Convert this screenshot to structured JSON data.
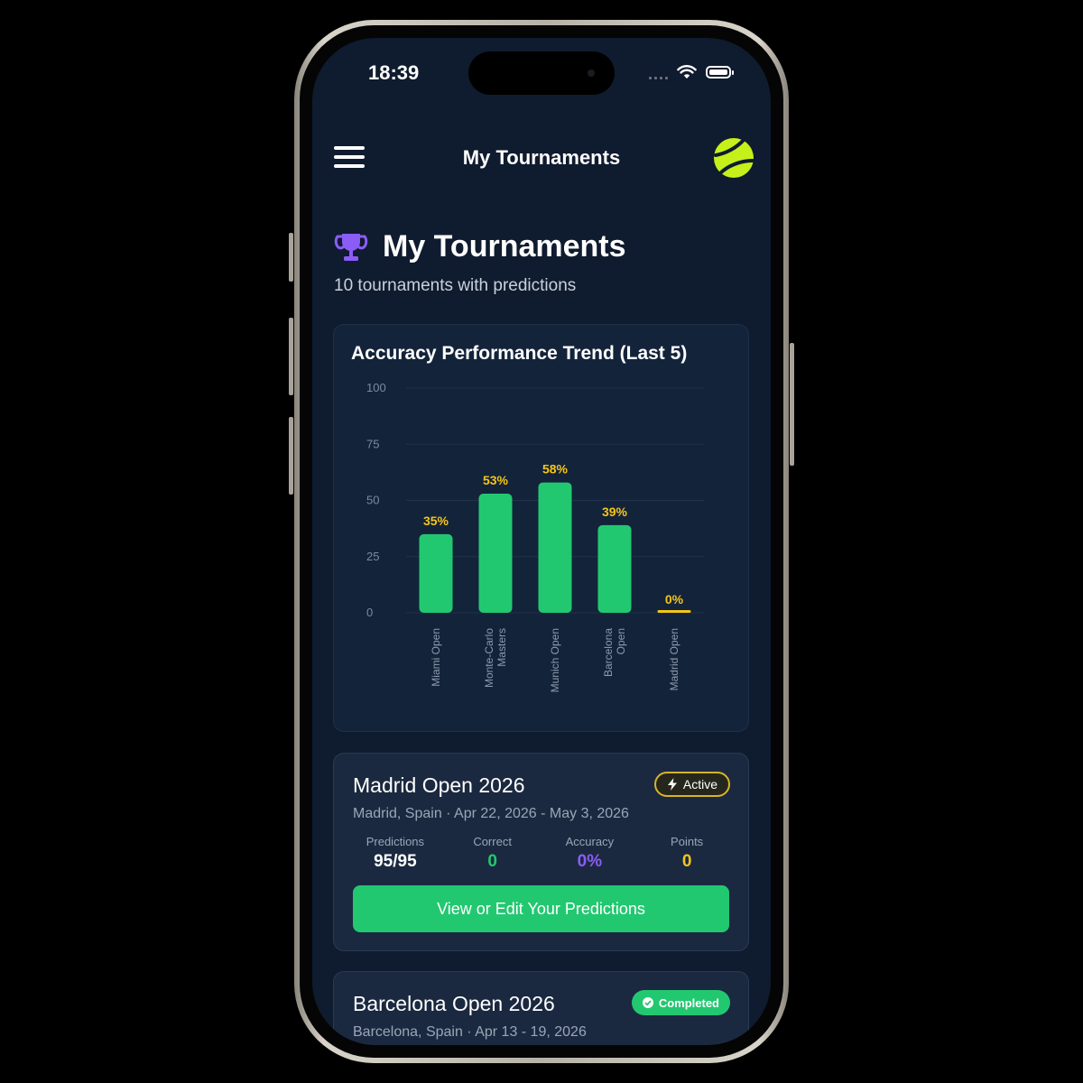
{
  "status_bar": {
    "time": "18:39"
  },
  "nav": {
    "title": "My Tournaments"
  },
  "header": {
    "title": "My Tournaments",
    "subtitle": "10 tournaments with predictions"
  },
  "chart_data": {
    "type": "bar",
    "title": "Accuracy Performance Trend (Last 5)",
    "categories": [
      "Miami Open",
      "Monte-Carlo Masters",
      "Munich Open",
      "Barcelona Open",
      "Madrid Open"
    ],
    "category_lines": [
      [
        "Miami Open"
      ],
      [
        "Monte-Carlo",
        "Masters"
      ],
      [
        "Munich Open"
      ],
      [
        "Barcelona",
        "Open"
      ],
      [
        "Madrid Open"
      ]
    ],
    "values": [
      35,
      53,
      58,
      39,
      0
    ],
    "data_labels": [
      "35%",
      "53%",
      "58%",
      "39%",
      "0%"
    ],
    "yticks": [
      0,
      25,
      50,
      75,
      100
    ],
    "ylim": [
      0,
      100
    ],
    "grid": true,
    "colors": {
      "bar": "#22c870",
      "label": "#f5c518",
      "zero_bar": "#f5c518"
    }
  },
  "tournaments": [
    {
      "name": "Madrid Open 2026",
      "meta": "Madrid, Spain · Apr 22, 2026 - May 3, 2026",
      "status": "Active",
      "stats": [
        {
          "label": "Predictions",
          "value": "95/95"
        },
        {
          "label": "Correct",
          "value": "0"
        },
        {
          "label": "Accuracy",
          "value": "0%"
        },
        {
          "label": "Points",
          "value": "0"
        }
      ],
      "button": "View or Edit Your Predictions"
    },
    {
      "name": "Barcelona Open 2026",
      "meta": "Barcelona, Spain · Apr 13 - 19, 2026",
      "status": "Completed"
    }
  ],
  "colors": {
    "accent_green": "#22c870",
    "accent_purple": "#8b5cf6",
    "accent_yellow": "#f5c518",
    "background": "#0f1b2e"
  }
}
